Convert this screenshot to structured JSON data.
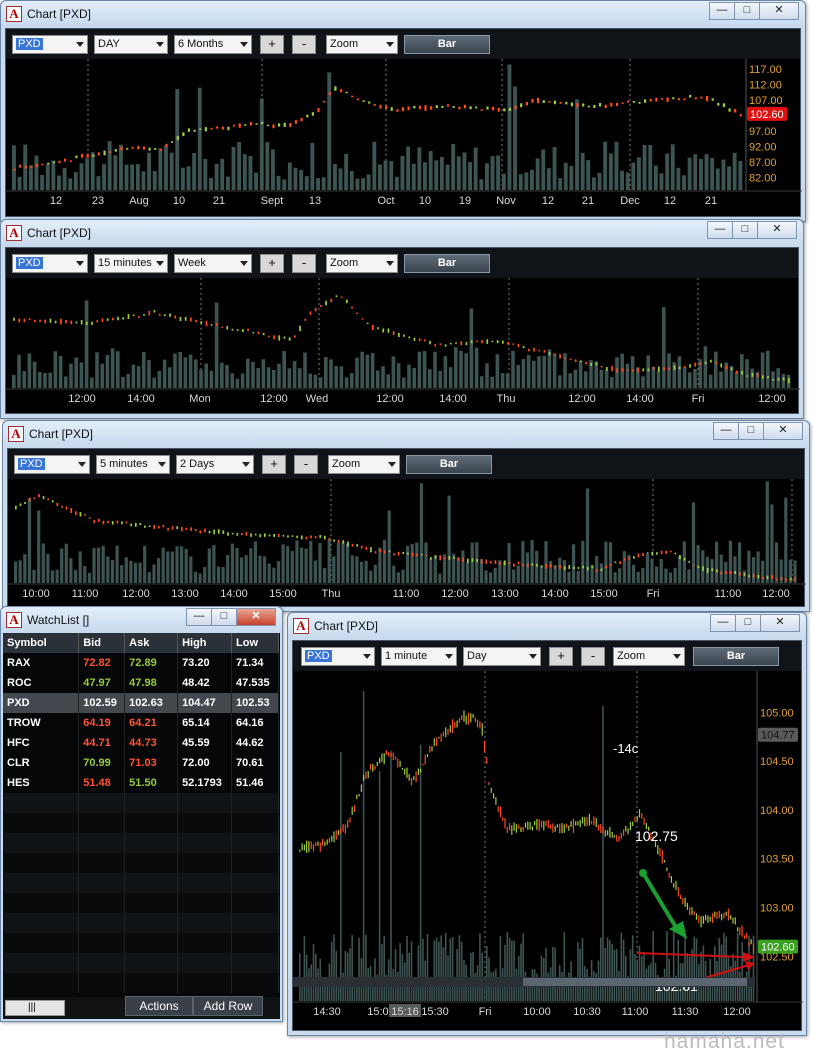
{
  "windows": [
    {
      "title": "Chart [PXD]",
      "symbol": "PXD",
      "interval": "DAY",
      "range": "6 Months",
      "plus": "+",
      "minus": "-",
      "zoom": "Zoom",
      "chart_type": "Bar",
      "win_buttons": {
        "minimize": "—",
        "maximize": "□",
        "close": "✕"
      }
    },
    {
      "title": "Chart [PXD]",
      "symbol": "PXD",
      "interval": "15 minutes",
      "range": "Week",
      "plus": "+",
      "minus": "-",
      "zoom": "Zoom",
      "chart_type": "Bar",
      "win_buttons": {
        "minimize": "—",
        "maximize": "□",
        "close": "✕"
      }
    },
    {
      "title": "Chart [PXD]",
      "symbol": "PXD",
      "interval": "5 minutes",
      "range": "2 Days",
      "plus": "+",
      "minus": "-",
      "zoom": "Zoom",
      "chart_type": "Bar",
      "win_buttons": {
        "minimize": "—",
        "maximize": "□",
        "close": "✕"
      }
    },
    {
      "title": "Chart [PXD]",
      "symbol": "PXD",
      "interval": "1 minute",
      "range": "Day",
      "plus": "+",
      "minus": "-",
      "zoom": "Zoom",
      "chart_type": "Bar",
      "win_buttons": {
        "minimize": "—",
        "maximize": "□",
        "close": "✕"
      }
    }
  ],
  "watchlist": {
    "title": "WatchList []",
    "columns": [
      "Symbol",
      "Bid",
      "Ask",
      "High",
      "Low"
    ],
    "rows": [
      {
        "symbol": "RAX",
        "bid": "72.82",
        "ask": "72.89",
        "high": "73.20",
        "low": "71.34",
        "bid_dir": "dn",
        "ask_dir": "up"
      },
      {
        "symbol": "ROC",
        "bid": "47.97",
        "ask": "47.98",
        "high": "48.42",
        "low": "47.535",
        "bid_dir": "up",
        "ask_dir": "up"
      },
      {
        "symbol": "PXD",
        "bid": "102.59",
        "ask": "102.63",
        "high": "104.47",
        "low": "102.53",
        "bid_dir": "none",
        "ask_dir": "none",
        "selected": true
      },
      {
        "symbol": "TROW",
        "bid": "64.19",
        "ask": "64.21",
        "high": "65.14",
        "low": "64.16",
        "bid_dir": "dn",
        "ask_dir": "dn"
      },
      {
        "symbol": "HFC",
        "bid": "44.71",
        "ask": "44.73",
        "high": "45.59",
        "low": "44.62",
        "bid_dir": "dn",
        "ask_dir": "dn"
      },
      {
        "symbol": "CLR",
        "bid": "70.99",
        "ask": "71.03",
        "high": "72.00",
        "low": "70.61",
        "bid_dir": "up",
        "ask_dir": "dn"
      },
      {
        "symbol": "HES",
        "bid": "51.48",
        "ask": "51.50",
        "high": "52.1793",
        "low": "51.46",
        "bid_dir": "dn",
        "ask_dir": "up"
      }
    ],
    "actions_label": "Actions",
    "add_row_label": "Add Row",
    "scroll_thumb": "|||",
    "win_buttons": {
      "minimize": "—",
      "maximize": "□",
      "close": "✕"
    }
  },
  "chart_data": [
    {
      "type": "bar",
      "y_ticks": [
        "117.00",
        "112.00",
        "107.00",
        "102.60",
        "97.00",
        "92.00",
        "87.00",
        "82.00"
      ],
      "y_tick_values": [
        117,
        112,
        107,
        102.6,
        97,
        92,
        87,
        82
      ],
      "ylim": [
        79,
        119
      ],
      "x_ticks": [
        "12",
        "23",
        "Aug",
        "10",
        "21",
        "Sept",
        "13",
        "Oct",
        "10",
        "19",
        "Nov",
        "12",
        "21",
        "Dec",
        "12",
        "21"
      ],
      "last_price": "102.60",
      "path": [
        [
          0,
          85
        ],
        [
          0.08,
          88
        ],
        [
          0.16,
          92
        ],
        [
          0.2,
          91
        ],
        [
          0.24,
          97
        ],
        [
          0.32,
          99
        ],
        [
          0.38,
          99
        ],
        [
          0.42,
          104
        ],
        [
          0.44,
          111
        ],
        [
          0.48,
          107
        ],
        [
          0.52,
          104
        ],
        [
          0.6,
          105
        ],
        [
          0.68,
          104
        ],
        [
          0.72,
          107
        ],
        [
          0.8,
          105
        ],
        [
          0.88,
          107
        ],
        [
          0.95,
          108
        ],
        [
          1,
          102.6
        ]
      ]
    },
    {
      "type": "bar",
      "x_ticks": [
        "12:00",
        "14:00",
        "Mon",
        "12:00",
        "Wed",
        "12:00",
        "14:00",
        "Thu",
        "12:00",
        "14:00",
        "Fri",
        "12:00"
      ],
      "path": [
        [
          0,
          0.35
        ],
        [
          0.1,
          0.38
        ],
        [
          0.18,
          0.28
        ],
        [
          0.26,
          0.4
        ],
        [
          0.36,
          0.55
        ],
        [
          0.38,
          0.3
        ],
        [
          0.42,
          0.1
        ],
        [
          0.46,
          0.42
        ],
        [
          0.55,
          0.6
        ],
        [
          0.62,
          0.55
        ],
        [
          0.7,
          0.7
        ],
        [
          0.78,
          0.85
        ],
        [
          0.86,
          0.82
        ],
        [
          0.9,
          0.76
        ],
        [
          0.94,
          0.88
        ],
        [
          1,
          0.95
        ]
      ]
    },
    {
      "type": "bar",
      "x_ticks": [
        "10:00",
        "11:00",
        "12:00",
        "13:00",
        "14:00",
        "15:00",
        "Thu",
        "11:00",
        "12:00",
        "13:00",
        "14:00",
        "15:00",
        "Fri",
        "11:00",
        "12:00"
      ],
      "path": [
        [
          0,
          0.25
        ],
        [
          0.03,
          0.12
        ],
        [
          0.1,
          0.38
        ],
        [
          0.2,
          0.45
        ],
        [
          0.3,
          0.52
        ],
        [
          0.4,
          0.55
        ],
        [
          0.46,
          0.68
        ],
        [
          0.55,
          0.75
        ],
        [
          0.65,
          0.82
        ],
        [
          0.75,
          0.86
        ],
        [
          0.8,
          0.72
        ],
        [
          0.84,
          0.68
        ],
        [
          0.88,
          0.86
        ],
        [
          0.94,
          0.93
        ],
        [
          1,
          0.96
        ]
      ]
    },
    {
      "type": "bar",
      "y_ticks": [
        "105.00",
        "104.50",
        "104.00",
        "103.50",
        "103.00",
        "102.50"
      ],
      "y_tick_values": [
        105,
        104.5,
        104,
        103.5,
        103,
        102.5
      ],
      "ylim": [
        102.35,
        105.3
      ],
      "x_ticks": [
        "14:30",
        "15:00",
        "15:16",
        "15:30",
        "Fri",
        "10:00",
        "10:30",
        "11:00",
        "11:30",
        "12:00"
      ],
      "highlight_tick": "15:16",
      "high_marker": "104.77",
      "last_price": "102.60",
      "annotations": {
        "change": "-14c",
        "top_price": "102.75",
        "bottom_price": "102.61"
      },
      "path": [
        [
          0,
          103.6
        ],
        [
          0.05,
          103.65
        ],
        [
          0.1,
          103.8
        ],
        [
          0.15,
          104.4
        ],
        [
          0.2,
          104.6
        ],
        [
          0.25,
          104.3
        ],
        [
          0.3,
          104.7
        ],
        [
          0.36,
          104.95
        ],
        [
          0.4,
          104.9
        ],
        [
          0.42,
          104.2
        ],
        [
          0.46,
          103.8
        ],
        [
          0.52,
          103.85
        ],
        [
          0.58,
          103.8
        ],
        [
          0.64,
          103.9
        ],
        [
          0.7,
          103.7
        ],
        [
          0.75,
          103.95
        ],
        [
          0.8,
          103.5
        ],
        [
          0.84,
          103.1
        ],
        [
          0.88,
          102.85
        ],
        [
          0.94,
          102.95
        ],
        [
          1,
          102.6
        ]
      ]
    }
  ],
  "watermark": "hamaha.net"
}
